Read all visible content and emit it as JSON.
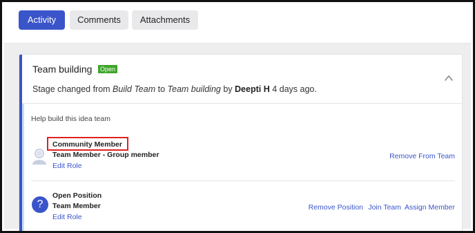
{
  "tabs": [
    {
      "label": "Activity",
      "active": true
    },
    {
      "label": "Comments",
      "active": false
    },
    {
      "label": "Attachments",
      "active": false
    }
  ],
  "card": {
    "title": "Team building",
    "status_badge": "Open",
    "stage_line": {
      "prefix": "Stage changed from ",
      "from_stage": "Build Team",
      "middle": " to ",
      "to_stage": "Team building",
      "by_text": " by ",
      "user": "Deepti H",
      "time": " 4 days ago."
    }
  },
  "team_section": {
    "help_text": "Help build this idea team",
    "members": [
      {
        "name": "Community Member",
        "role": "Team Member - Group member",
        "edit_label": "Edit Role",
        "actions": [
          "Remove From Team"
        ]
      },
      {
        "name": "Open Position",
        "role": "Team Member",
        "edit_label": "Edit Role",
        "actions": [
          "Remove Position",
          "Join Team",
          "Assign Member"
        ]
      }
    ]
  },
  "colors": {
    "accent": "#3a55c9",
    "badge_green": "#3fa52a",
    "highlight_red": "#e02020"
  },
  "icons": {
    "avatar_placeholder": "user-silhouette-icon",
    "open_position": "question-mark-icon",
    "collapse": "chevron-up-icon"
  }
}
